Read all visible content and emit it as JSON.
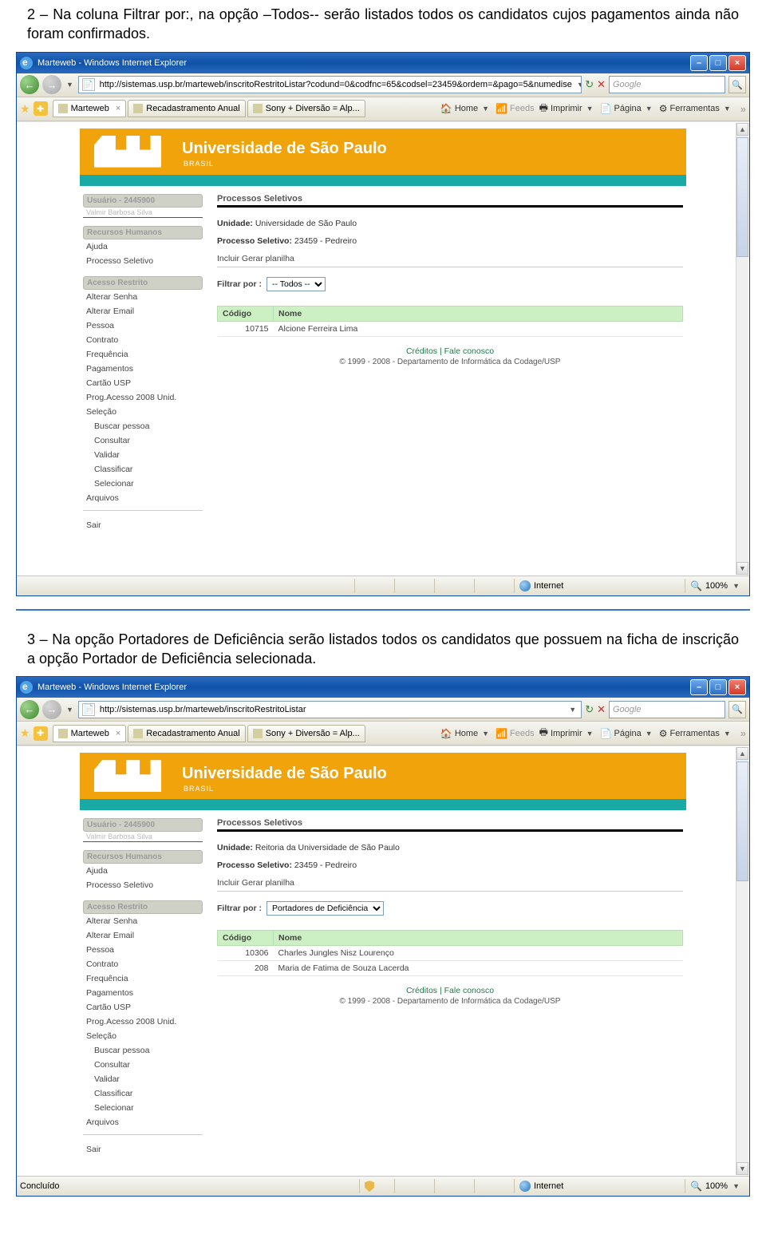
{
  "doc": {
    "para1": "2 – Na coluna Filtrar por:, na opção –Todos-- serão listados todos os candidatos cujos pagamentos ainda não foram confirmados.",
    "para2": "3 – Na opção Portadores de Deficiência serão listados todos os candidatos que possuem na ficha de inscrição a opção Portador de Deficiência selecionada."
  },
  "window_title": "Marteweb - Windows Internet Explorer",
  "wincontrols": {
    "min": "–",
    "max": "□",
    "close": "×"
  },
  "toolbar": {
    "home": "Home",
    "feeds": "Feeds",
    "print": "Imprimir",
    "page": "Página",
    "tools": "Ferramentas"
  },
  "tabs": {
    "t1": "Marteweb",
    "t2": "Recadastramento Anual",
    "t3": "Sony + Diversão = Alp..."
  },
  "search_placeholder": "Google",
  "status": {
    "done": "Concluído",
    "internet": "Internet",
    "zoom": "100%"
  },
  "usp": {
    "title": "Universidade de São Paulo",
    "sub": "BRASIL"
  },
  "sidebar": {
    "user_block": "Usuário - 2445900",
    "user_name": "Valmir Barbosa Silva",
    "rh": "Recursos Humanos",
    "ajuda": "Ajuda",
    "proc_sel": "Processo Seletivo",
    "acesso": "Acesso Restrito",
    "links": {
      "alterar_senha": "Alterar Senha",
      "alterar_email": "Alterar Email",
      "pessoa": "Pessoa",
      "contrato": "Contrato",
      "frequencia": "Frequência",
      "pagamentos": "Pagamentos",
      "cartao": "Cartão USP",
      "prog": "Prog.Acesso 2008 Unid.",
      "selecao": "Seleção",
      "buscar": "Buscar pessoa",
      "consultar": "Consultar",
      "validar": "Validar",
      "classificar": "Classificar",
      "selecionar": "Selecionar",
      "arquivos": "Arquivos",
      "sair": "Sair"
    }
  },
  "footer": {
    "creditos": "Créditos",
    "sep": " | ",
    "fale": "Fale conosco",
    "copy": "© 1999 - 2008 - Departamento de Informática da Codage/USP"
  },
  "shot1": {
    "url": "http://sistemas.usp.br/marteweb/inscritoRestritoListar?codund=0&codfnc=65&codsel=23459&ordem=&pago=5&numedise",
    "main": {
      "crumb": "Processos Seletivos",
      "unidade_lbl": "Unidade:",
      "unidade_val": "Universidade de São Paulo",
      "proc_lbl": "Processo Seletivo:",
      "proc_val": "23459 - Pedreiro",
      "actions": "Incluir  Gerar planilha",
      "filter_lbl": "Filtrar por :",
      "filter_val": "-- Todos --",
      "th_cod": "Código",
      "th_nome": "Nome",
      "rows": [
        {
          "cod": "10715",
          "nome": "Alcione Ferreira Lima"
        }
      ]
    }
  },
  "shot2": {
    "url": "http://sistemas.usp.br/marteweb/inscritoRestritoListar",
    "main": {
      "crumb": "Processos Seletivos",
      "unidade_lbl": "Unidade:",
      "unidade_val": "Reitoria da Universidade de São Paulo",
      "proc_lbl": "Processo Seletivo:",
      "proc_val": "23459 - Pedreiro",
      "actions": "Incluir  Gerar planilha",
      "filter_lbl": "Filtrar por :",
      "filter_val": "Portadores de Deficiência",
      "th_cod": "Código",
      "th_nome": "Nome",
      "rows": [
        {
          "cod": "10306",
          "nome": "Charles Jungles Nisz Lourenço"
        },
        {
          "cod": "208",
          "nome": "Maria de Fatima de Souza Lacerda"
        }
      ]
    }
  }
}
